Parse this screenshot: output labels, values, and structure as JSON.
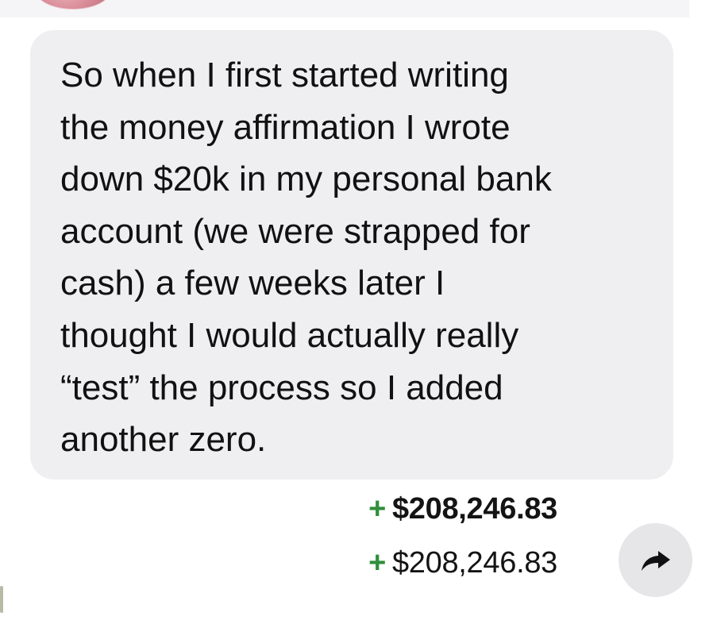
{
  "message": {
    "lines": [
      "So when I first started writing",
      "the money affirmation I wrote",
      "down $20k in my personal bank",
      "account (we were strapped for",
      "cash) a few weeks later I",
      "thought I would actually really",
      "“test” the process so I added",
      "another zero."
    ]
  },
  "attachment": {
    "amount_bold": {
      "sign": "+",
      "value": "$208,246.83"
    },
    "amount_regular": {
      "sign": "+",
      "value": "$208,246.83"
    }
  },
  "share_button": {
    "icon": "share-arrow-icon"
  },
  "colors": {
    "bubble_bg": "#efeff2",
    "plus_green": "#2f8f3a",
    "share_bg": "#e6e6e9"
  }
}
